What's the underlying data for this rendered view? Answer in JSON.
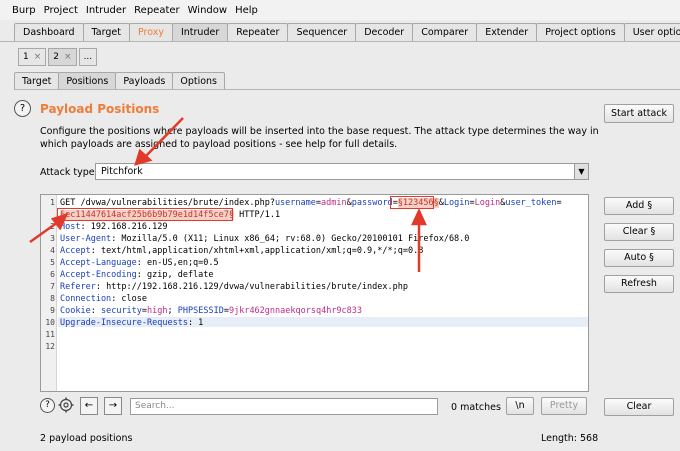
{
  "menu": [
    "Burp",
    "Project",
    "Intruder",
    "Repeater",
    "Window",
    "Help"
  ],
  "main_tabs": [
    {
      "label": "Dashboard"
    },
    {
      "label": "Target"
    },
    {
      "label": "Proxy"
    },
    {
      "label": "Intruder"
    },
    {
      "label": "Repeater"
    },
    {
      "label": "Sequencer"
    },
    {
      "label": "Decoder"
    },
    {
      "label": "Comparer"
    },
    {
      "label": "Extender"
    },
    {
      "label": "Project options"
    },
    {
      "label": "User options"
    }
  ],
  "attack_tabs": [
    {
      "label": "1",
      "close": "×"
    },
    {
      "label": "2",
      "close": "×"
    },
    {
      "label": "..."
    }
  ],
  "sub_tabs": [
    "Target",
    "Positions",
    "Payloads",
    "Options"
  ],
  "panel": {
    "help": "?",
    "title": "Payload Positions",
    "description": "Configure the positions where payloads will be inserted into the base request. The attack type determines the way in which payloads are assigned to payload positions - see help for full details.",
    "start_attack": "Start attack",
    "attack_type_label": "Attack type:",
    "attack_type_value": "Pitchfork"
  },
  "side_buttons": {
    "add": "Add §",
    "clear": "Clear §",
    "auto": "Auto §",
    "refresh": "Refresh"
  },
  "request": {
    "line1": {
      "pre": "GET /dvwa/vulnerabilities/brute/index.php?",
      "k1": "username",
      "eq1": "=",
      "v1": "admin",
      "amp1": "&",
      "k2": "password",
      "eq2": "=",
      "payload1": "§123456§",
      "amp2": "&",
      "k3": "Login",
      "eq3": "=",
      "v3": "Login",
      "amp3": "&",
      "k4": "user_token",
      "eq4": "="
    },
    "line1b": {
      "payload2": "§ec11447614acf25b6b9b79e1d14f5ce7§",
      "rest": " HTTP/1.1"
    },
    "headers": [
      {
        "name": "Host",
        "value": ": 192.168.216.129"
      },
      {
        "name": "User-Agent",
        "value": ": Mozilla/5.0 (X11; Linux x86_64; rv:68.0) Gecko/20100101 Firefox/68.0"
      },
      {
        "name": "Accept",
        "value": ": text/html,application/xhtml+xml,application/xml;q=0.9,*/*;q=0.8"
      },
      {
        "name": "Accept-Language",
        "value": ": en-US,en;q=0.5"
      },
      {
        "name": "Accept-Encoding",
        "value": ": gzip, deflate"
      },
      {
        "name": "Referer",
        "value": ": http://192.168.216.129/dvwa/vulnerabilities/brute/index.php"
      },
      {
        "name": "Connection",
        "value": ": close"
      }
    ],
    "cookie": {
      "name": "Cookie",
      "pre": ": ",
      "k1": "security",
      "eq": "=",
      "v1": "high",
      "sep": "; ",
      "k2": "PHPSESSID",
      "eq2": "=",
      "v2": "9jkr462gnnaekqorsq4hr9c833"
    },
    "upgrade": {
      "name": "Upgrade-Insecure-Requests",
      "value": ": 1"
    },
    "line_numbers": [
      "1",
      "2",
      "3",
      "4",
      "5",
      "6",
      "7",
      "8",
      "9",
      "10",
      "11",
      "12"
    ]
  },
  "search": {
    "placeholder": "Search...",
    "matches": "0 matches",
    "regex": "\\n",
    "pretty": "Pretty"
  },
  "clear_button": "Clear",
  "status": {
    "positions": "2 payload positions",
    "length": "Length: 568"
  }
}
